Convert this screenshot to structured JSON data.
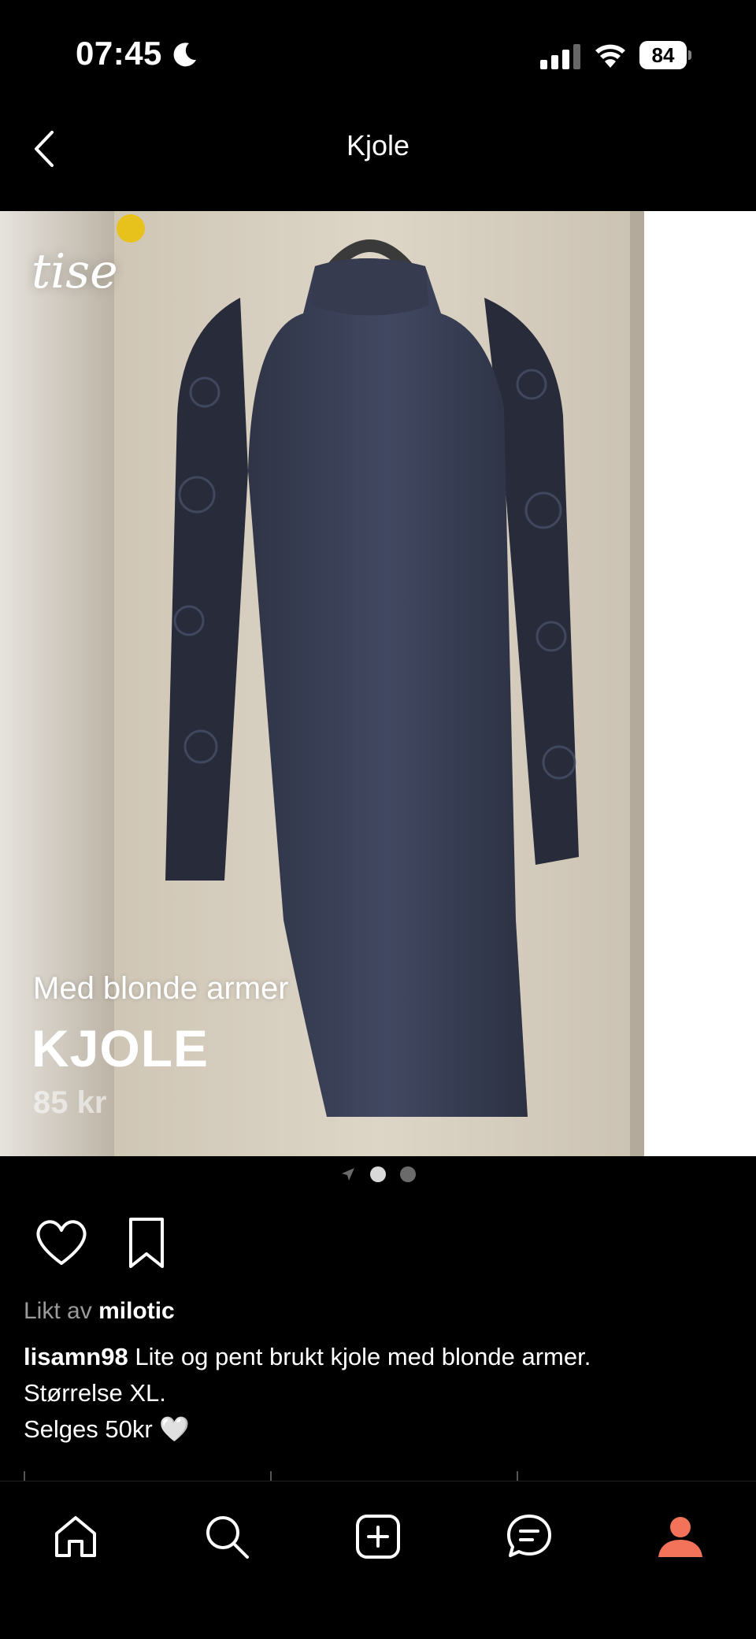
{
  "status_bar": {
    "time": "07:45",
    "battery_level": "84",
    "icons": [
      "moon-icon",
      "signal-icon",
      "wifi-icon",
      "battery-icon"
    ]
  },
  "header": {
    "title": "Kjole",
    "back_icon": "chevron-left-icon"
  },
  "listing_image": {
    "watermark": "tise",
    "subtitle": "Med blonde armer",
    "title": "KJOLE",
    "price": "85 kr"
  },
  "carousel": {
    "current_page": 1,
    "total_dots": 2
  },
  "post": {
    "liked_by_prefix": "Likt av",
    "liked_by_user": "milotic",
    "username": "lisamn98",
    "caption_line1": "Lite og pent brukt kjole med blonde armer.",
    "caption_line2": "Størrelse XL.",
    "caption_line3": "Selges 50kr 🤍"
  },
  "tab_bar": {
    "items": [
      "home-icon",
      "search-icon",
      "add-icon",
      "messages-icon",
      "profile-icon"
    ],
    "active_color": "#f2725a"
  },
  "colors": {
    "background": "#000000",
    "text": "#ffffff",
    "muted": "#9a9a9a",
    "accent": "#f2725a"
  }
}
